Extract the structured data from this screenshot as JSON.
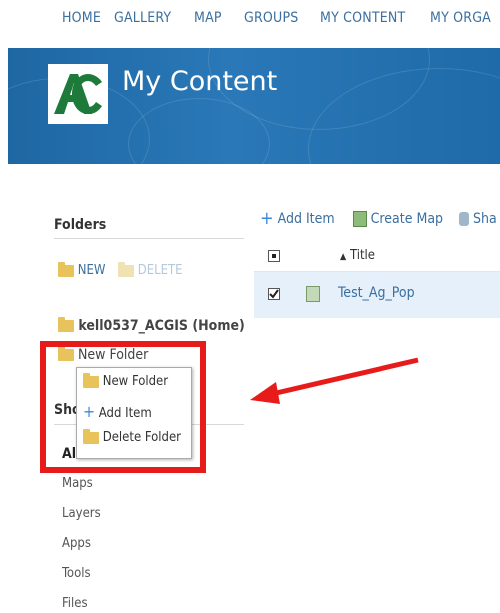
{
  "nav": {
    "items": [
      "HOME",
      "GALLERY",
      "MAP",
      "GROUPS",
      "MY CONTENT",
      "MY ORGA"
    ]
  },
  "header": {
    "title": "My Content",
    "banner_color": "#2a72b0",
    "logo_color": "#1e7a3a"
  },
  "sidebar": {
    "folders_heading": "Folders",
    "new_label": "NEW",
    "delete_label": "DELETE",
    "home_folder": "kell0537_ACGIS (Home)",
    "new_folder": "New Folder",
    "show_heading": "Sho",
    "show_items": [
      "All",
      "Maps",
      "Layers",
      "Apps",
      "Tools",
      "Files"
    ]
  },
  "context_menu": {
    "items": [
      "New Folder",
      "Add Item",
      "Delete Folder"
    ]
  },
  "toolbar": {
    "add_item": "Add Item",
    "create_map": "Create Map",
    "share": "Sha"
  },
  "table": {
    "title_header": "Title",
    "rows": [
      {
        "title": "Test_Ag_Pop",
        "checked": true
      }
    ]
  },
  "annotation": {
    "color": "#e81b1b"
  }
}
